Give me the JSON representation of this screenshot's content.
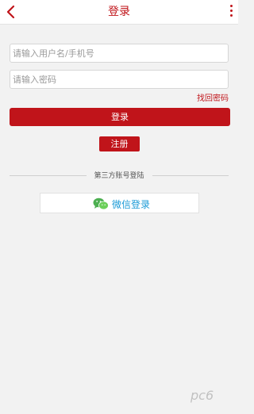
{
  "header": {
    "title": "登录"
  },
  "login_form": {
    "username_placeholder": "请输入用户名/手机号",
    "password_placeholder": "请输入密码",
    "forgot_password_label": "找回密码",
    "login_button_label": "登录",
    "register_button_label": "注册"
  },
  "third_party": {
    "section_label": "第三方账号登陆",
    "wechat_button_label": "微信登录"
  },
  "watermark": {
    "text": "pc6"
  },
  "colors": {
    "accent": "#c0141a",
    "wechat_green": "#4caf50",
    "wechat_text": "#1a9ad6",
    "background": "#f2f2f2"
  }
}
